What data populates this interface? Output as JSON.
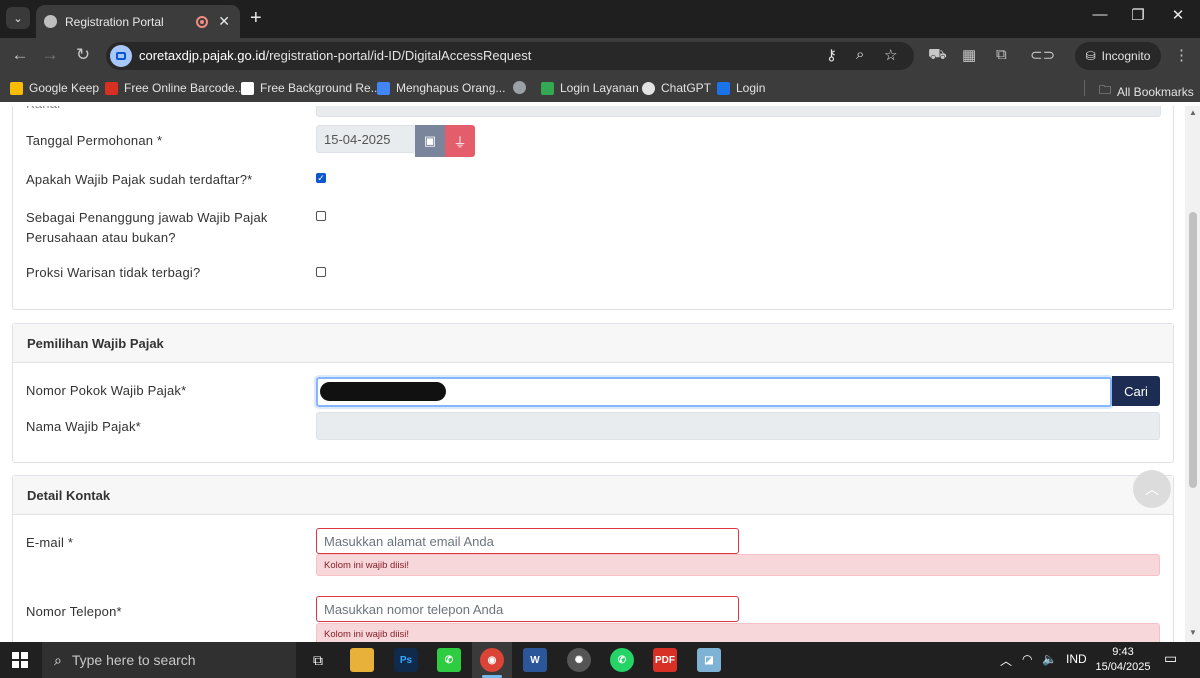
{
  "browser": {
    "tab_title": "Registration Portal",
    "new_tab_icon": "+",
    "url_host": "coretaxdjp.pajak.go.id",
    "url_path": "/registration-portal/id-ID/DigitalAccessRequest",
    "incognito_label": "Incognito",
    "bookmarks": [
      {
        "label": "Google Keep",
        "color": "#fbbc04"
      },
      {
        "label": "Free Online Barcode...",
        "color": "#d93025"
      },
      {
        "label": "Free Background Re...",
        "color": "#ffffff"
      },
      {
        "label": "Menghapus Orang...",
        "color": "#4285f4"
      },
      {
        "label": "",
        "color": "#9aa0a6"
      },
      {
        "label": "Login Layanan",
        "color": "#34a853"
      },
      {
        "label": "ChatGPT",
        "color": "#e3e3e3"
      },
      {
        "label": "Login",
        "color": "#1a73e8"
      }
    ],
    "all_bookmarks": "All Bookmarks"
  },
  "form": {
    "truncated_label": "Kanal",
    "date_label": "Tanggal Permohonan *",
    "date_value": "15-04-2025",
    "registered_label": "Apakah Wajib Pajak sudah terdaftar?*",
    "registered_checked": true,
    "responsible_label_1": "Sebagai Penanggung jawab Wajib Pajak",
    "responsible_label_2": "Perusahaan atau bukan?",
    "proxy_label": "Proksi Warisan tidak terbagi?",
    "taxpayer_section": "Pemilihan Wajib Pajak",
    "npwp_label": "Nomor Pokok Wajib Pajak*",
    "search_button": "Cari",
    "taxpayer_name_label": "Nama Wajib Pajak*",
    "contact_section": "Detail Kontak",
    "email_label": "E-mail *",
    "email_placeholder": "Masukkan alamat email Anda",
    "email_error": "Kolom ini wajib diisi!",
    "phone_label": "Nomor Telepon*",
    "phone_placeholder": "Masukkan nomor telepon Anda",
    "phone_error": "Kolom ini wajib diisi!"
  },
  "taskbar": {
    "search_placeholder": "Type here to search",
    "language": "IND",
    "time": "9:43",
    "date": "15/04/2025",
    "apps": [
      "task-view",
      "file-explorer",
      "photoshop",
      "phone-link",
      "chrome",
      "word",
      "app-red",
      "whatsapp",
      "pdf-editor",
      "app-blue"
    ]
  },
  "colors": {
    "error": "#dc3545",
    "error_bg": "#f8d7da",
    "search_button_bg": "#1d2c53",
    "focus_border": "#86b7fe"
  }
}
